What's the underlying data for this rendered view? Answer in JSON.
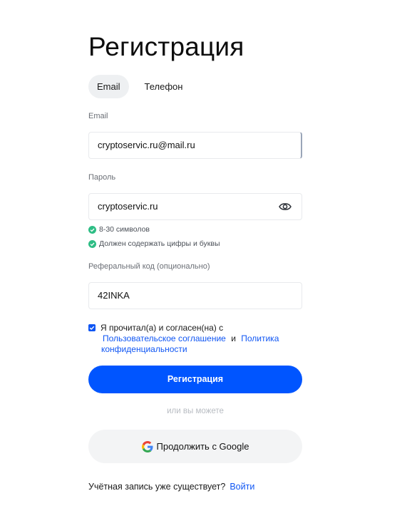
{
  "page": {
    "title": "Регистрация"
  },
  "tabs": [
    {
      "label": "Email",
      "active": true
    },
    {
      "label": "Телефон",
      "active": false
    }
  ],
  "email": {
    "label": "Email",
    "value": "cryptoservic.ru@mail.ru"
  },
  "password": {
    "label": "Пароль",
    "value": "cryptoservic.ru",
    "toggle_icon": "eye-icon",
    "hints": [
      {
        "text": "8-30 символов",
        "status": "ok"
      },
      {
        "text": "Должен содержать цифры и буквы",
        "status": "ok"
      }
    ]
  },
  "referral": {
    "label": "Реферальный код (опционально)",
    "value": "42INKA"
  },
  "agreement": {
    "checked": true,
    "text": "Я прочитал(а) и согласен(на) с",
    "link1": "Пользовательское соглашение",
    "and": "и",
    "link2a": "Политика",
    "link2b": "конфиденциальности"
  },
  "submit_label": "Регистрация",
  "or_text": "или вы можете",
  "google_label": "Продолжить с Google",
  "footer": {
    "text": "Учётная запись уже существует?",
    "link": "Войти"
  },
  "colors": {
    "accent": "#0055ff",
    "check_ok": "#2ebd85",
    "link": "#0f56f4"
  }
}
